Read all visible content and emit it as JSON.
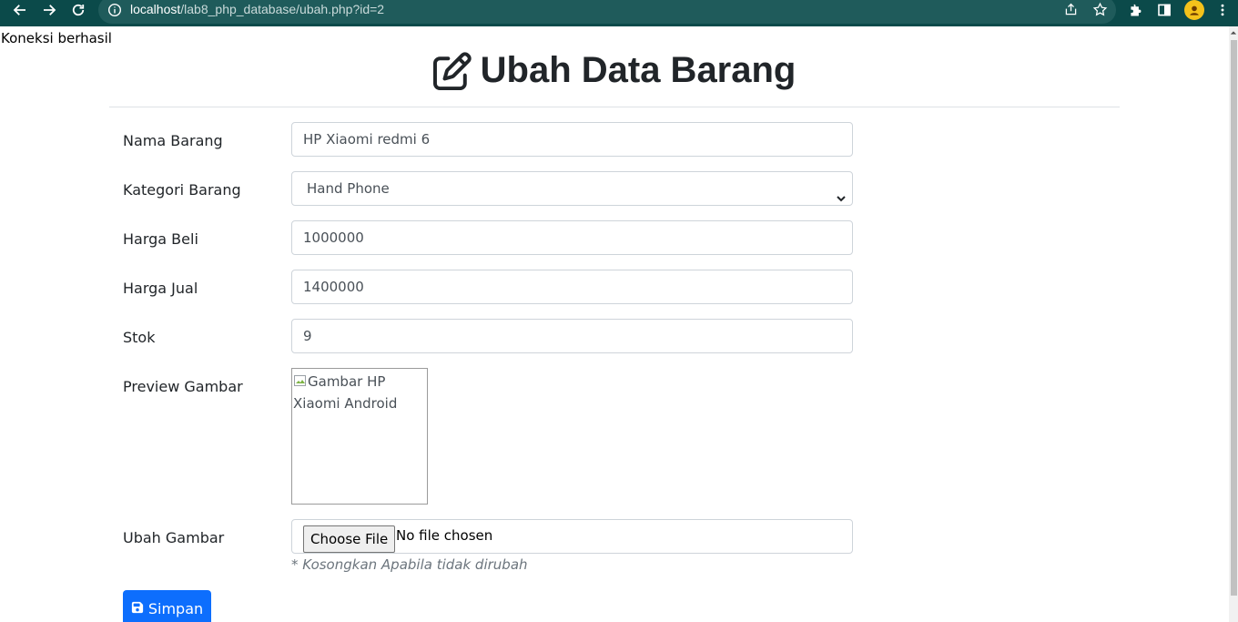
{
  "browser": {
    "url_host": "localhost",
    "url_path": "/lab8_php_database/ubah.php?id=2",
    "icons": [
      "back-icon",
      "forward-icon",
      "reload-icon",
      "info-icon",
      "share-icon",
      "star-icon",
      "extensions-icon",
      "side-panel-icon",
      "avatar",
      "menu-icon"
    ]
  },
  "page": {
    "status_message": "Koneksi berhasil",
    "title": "Ubah Data Barang"
  },
  "form": {
    "nama_barang": {
      "label": "Nama Barang",
      "value": "HP Xiaomi redmi 6"
    },
    "kategori": {
      "label": "Kategori Barang",
      "value": "Hand Phone"
    },
    "harga_beli": {
      "label": "Harga Beli",
      "value": "1000000"
    },
    "harga_jual": {
      "label": "Harga Jual",
      "value": "1400000"
    },
    "stok": {
      "label": "Stok",
      "value": "9"
    },
    "preview": {
      "label": "Preview Gambar",
      "alt_text": "Gambar HP Xiaomi Android"
    },
    "ubah_gambar": {
      "label": "Ubah Gambar",
      "button_label": "Choose File",
      "status": "No file chosen",
      "hint": "* Kosongkan Apabila tidak dirubah"
    },
    "submit_label": "Simpan"
  },
  "colors": {
    "chrome": "#0b4a4a",
    "primary": "#0d6efd",
    "text": "#212529",
    "muted": "#6c757d"
  }
}
